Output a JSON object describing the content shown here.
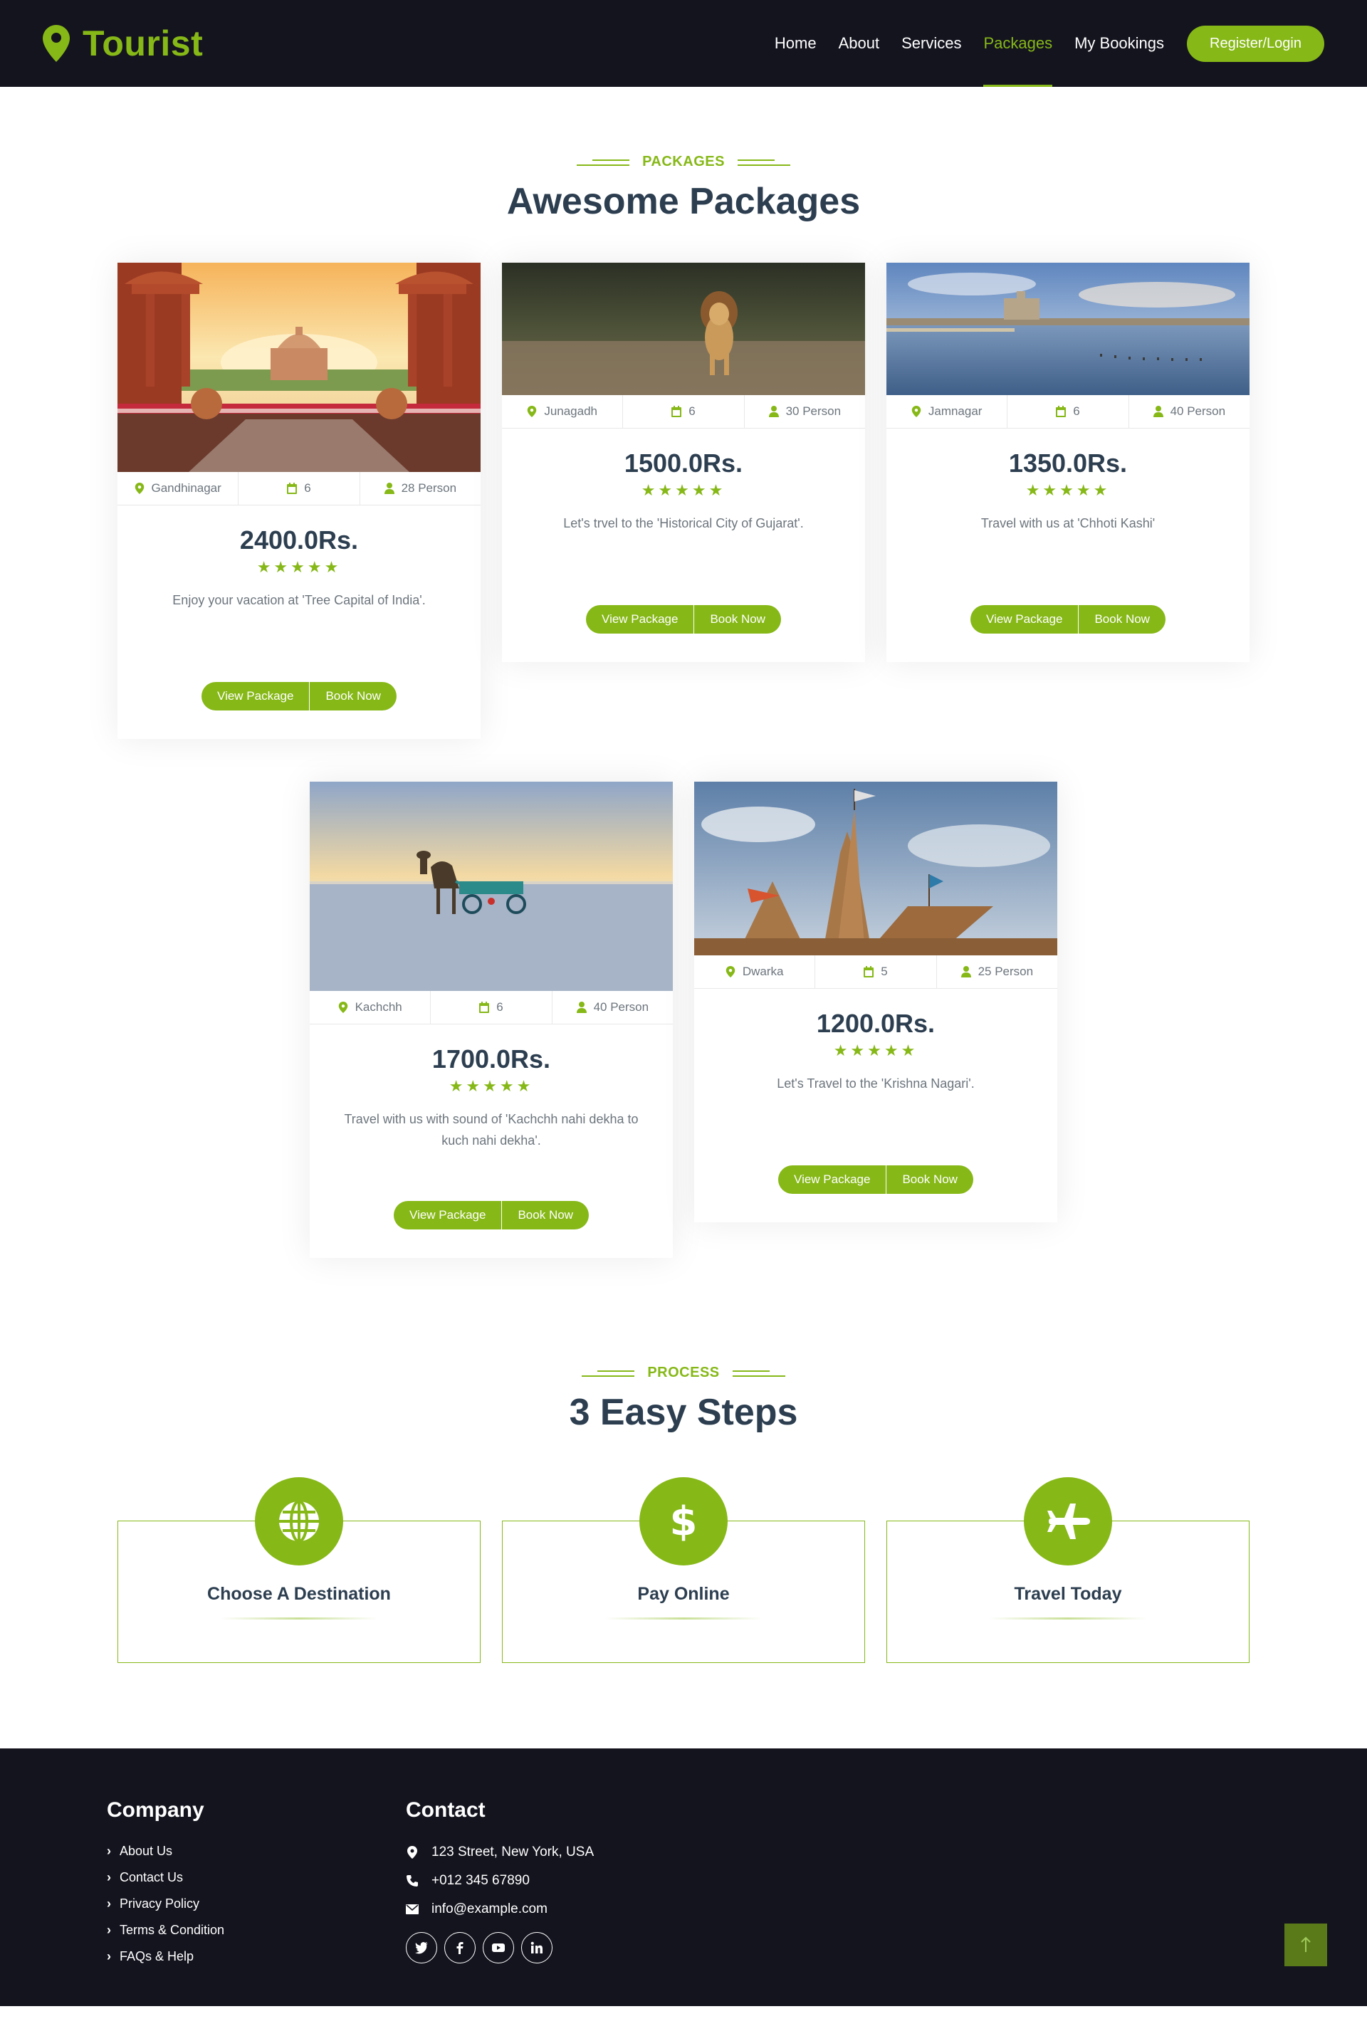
{
  "brand": {
    "name": "Tourist",
    "icon": "map-pin-icon"
  },
  "nav": {
    "items": [
      "Home",
      "About",
      "Services",
      "Packages",
      "My Bookings"
    ],
    "active": "Packages",
    "register_label": "Register/Login"
  },
  "packages_section": {
    "eyebrow": "PACKAGES",
    "title": "Awesome Packages"
  },
  "packages": [
    {
      "location": "Gandhinagar",
      "days": "6",
      "persons": "28 Person",
      "price": "2400.0Rs.",
      "rating": 5,
      "description": "Enjoy your vacation at 'Tree Capital of India'."
    },
    {
      "location": "Junagadh",
      "days": "6",
      "persons": "30 Person",
      "price": "1500.0Rs.",
      "rating": 5,
      "description": "Let's trvel to the 'Historical City of Gujarat'."
    },
    {
      "location": "Jamnagar",
      "days": "6",
      "persons": "40 Person",
      "price": "1350.0Rs.",
      "rating": 5,
      "description": "Travel with us at 'Chhoti Kashi'"
    },
    {
      "location": "Kachchh",
      "days": "6",
      "persons": "40 Person",
      "price": "1700.0Rs.",
      "rating": 5,
      "description": "Travel with us with sound of 'Kachchh nahi dekha to kuch nahi dekha'."
    },
    {
      "location": "Dwarka",
      "days": "5",
      "persons": "25 Person",
      "price": "1200.0Rs.",
      "rating": 5,
      "description": "Let's Travel to the 'Krishna Nagari'."
    }
  ],
  "buttons": {
    "view": "View Package",
    "book": "Book Now"
  },
  "process_section": {
    "eyebrow": "PROCESS",
    "title": "3 Easy Steps",
    "steps": [
      {
        "title": "Choose A Destination",
        "icon": "globe-icon"
      },
      {
        "title": "Pay Online",
        "icon": "dollar-icon"
      },
      {
        "title": "Travel Today",
        "icon": "plane-icon"
      }
    ]
  },
  "footer": {
    "company_title": "Company",
    "company_links": [
      "About Us",
      "Contact Us",
      "Privacy Policy",
      "Terms & Condition",
      "FAQs & Help"
    ],
    "contact_title": "Contact",
    "address": "123 Street, New York, USA",
    "phone": "+012 345 67890",
    "email": "info@example.com",
    "socials": [
      "twitter-icon",
      "facebook-icon",
      "youtube-icon",
      "linkedin-icon"
    ]
  },
  "colors": {
    "accent": "#86b817",
    "dark": "#14141f",
    "heading": "#2c3e50",
    "muted": "#6c757d"
  }
}
